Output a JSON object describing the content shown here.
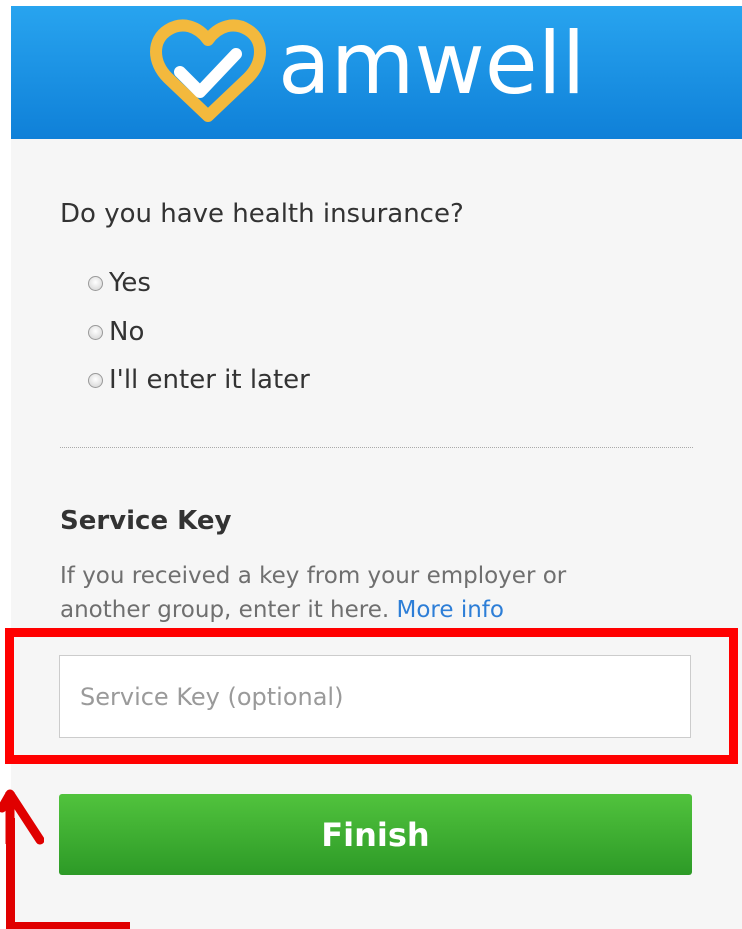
{
  "header": {
    "brand_name": "amwell",
    "logo_icon": "heart-check-icon",
    "colors": {
      "gradient_top": "#28a4ef",
      "gradient_bottom": "#0f80d8",
      "logo_mark": "#f3b93d"
    }
  },
  "insurance": {
    "question": "Do you have health insurance?",
    "options": [
      {
        "label": "Yes",
        "selected": false
      },
      {
        "label": "No",
        "selected": false
      },
      {
        "label": "I'll enter it later",
        "selected": false
      }
    ]
  },
  "service_key": {
    "title": "Service Key",
    "description": "If you received a key from your employer or another group, enter it here.",
    "more_info_link": "More info",
    "input_value": "",
    "input_placeholder": "Service Key (optional)"
  },
  "actions": {
    "finish_label": "Finish",
    "finish_color": "#3bab2f"
  },
  "annotation": {
    "highlight_color": "#ff0000",
    "arrow_icon": "arrow-up-icon"
  }
}
